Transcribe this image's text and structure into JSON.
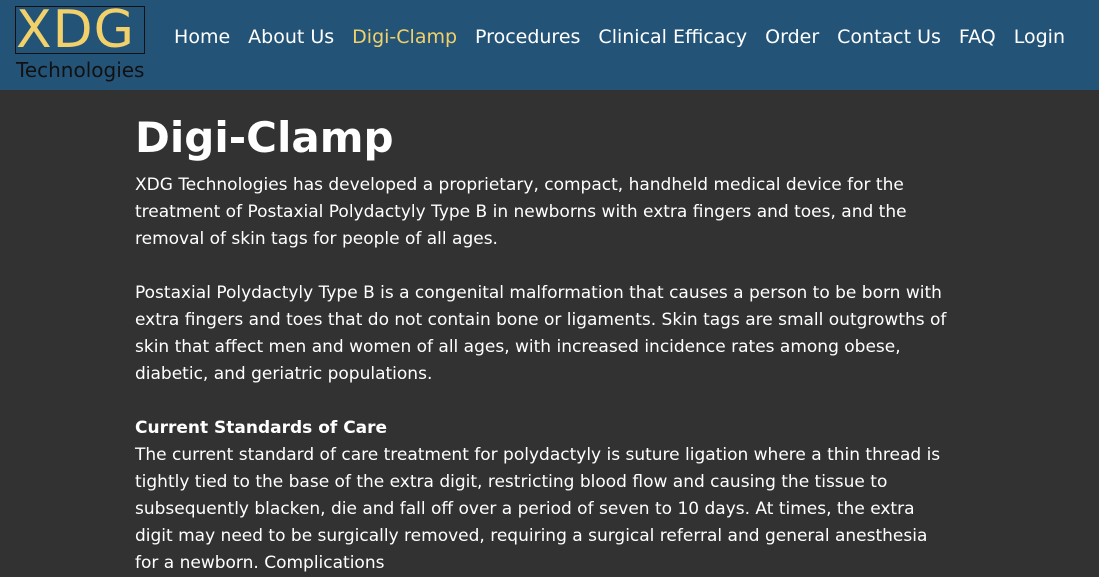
{
  "brand": {
    "mark": "XDG",
    "subtitle": "Technologies",
    "accent_color": "#f2d06a",
    "header_color": "#235478"
  },
  "nav": {
    "items": [
      {
        "label": "Home",
        "active": false
      },
      {
        "label": "About Us",
        "active": false
      },
      {
        "label": "Digi-Clamp",
        "active": true
      },
      {
        "label": "Procedures",
        "active": false
      },
      {
        "label": "Clinical Efficacy",
        "active": false
      },
      {
        "label": "Order",
        "active": false
      },
      {
        "label": "Contact Us",
        "active": false
      },
      {
        "label": "FAQ",
        "active": false
      },
      {
        "label": "Login",
        "active": false
      }
    ]
  },
  "main": {
    "title": "Digi-Clamp",
    "intro": "XDG Technologies has developed a proprietary, compact, handheld medical device for the treatment of Postaxial Polydactyly Type B in newborns with extra fingers and toes, and the removal of skin tags for people of all ages.",
    "description": "Postaxial Polydactyly Type B is a congenital malformation that causes a person to be born with extra fingers and toes that do not contain bone or ligaments. Skin tags are small outgrowths of skin that affect men and women of all ages, with increased incidence rates among obese, diabetic, and geriatric populations.",
    "standards_heading": "Current Standards of Care",
    "standards_body": "The current standard of care treatment for polydactyly is suture ligation where a thin thread is tightly tied to the base of the extra digit, restricting blood flow and causing the tissue to subsequently blacken, die and fall off over a period of seven to 10 days. At times, the extra digit may need to be surgically removed, requiring a surgical referral and general anesthesia for a newborn. Complications"
  }
}
